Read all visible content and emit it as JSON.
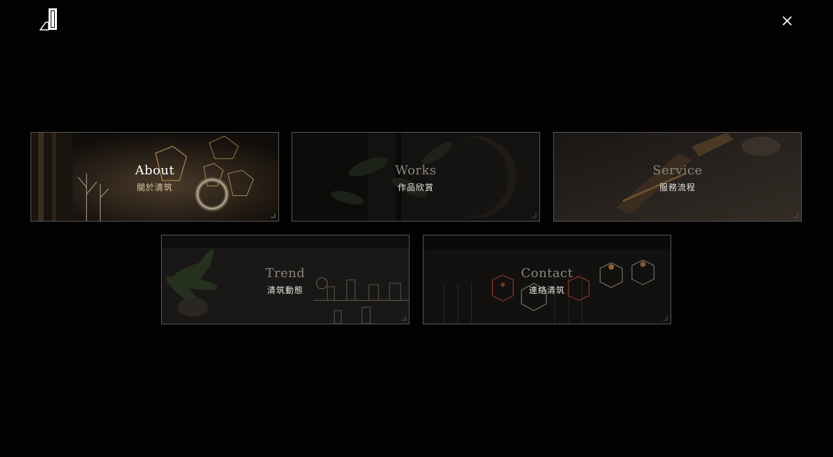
{
  "header": {
    "logo_icon": "door-logo-icon",
    "close_icon": "close-icon"
  },
  "menu": {
    "items": [
      {
        "title": "About",
        "subtitle": "關於清筑",
        "active": true
      },
      {
        "title": "Works",
        "subtitle": "作品欣賞",
        "active": false
      },
      {
        "title": "Service",
        "subtitle": "服務流程",
        "active": false
      },
      {
        "title": "Trend",
        "subtitle": "清筑動態",
        "active": false
      },
      {
        "title": "Contact",
        "subtitle": "連絡清筑",
        "active": false
      }
    ]
  },
  "colors": {
    "background": "#020202",
    "card_border": "#5a5854",
    "active_subtitle": "#d6c79e",
    "inactive_title": "#8a8680"
  }
}
